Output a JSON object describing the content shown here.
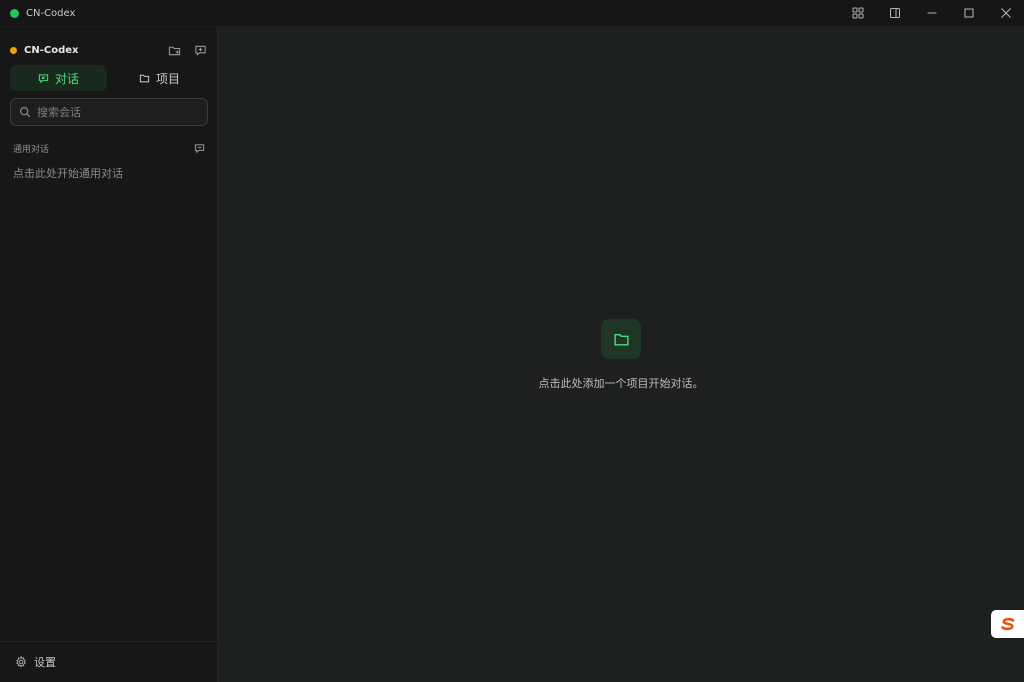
{
  "window": {
    "title": "CN-Codex",
    "status_color": "#22c55e"
  },
  "sidebar": {
    "workspace": {
      "name": "CN-Codex",
      "status_color": "#f59e0b"
    },
    "tabs": [
      {
        "label": "对话",
        "icon": "chat-icon",
        "active": true
      },
      {
        "label": "项目",
        "icon": "folder-icon",
        "active": false
      }
    ],
    "search": {
      "placeholder": "搜索会话",
      "value": ""
    },
    "section": {
      "title": "通用对话",
      "hint": "点击此处开始通用对话"
    },
    "footer": {
      "settings_label": "设置"
    }
  },
  "main": {
    "empty_state": {
      "icon": "folder-icon",
      "text": "点击此处添加一个项目开始对话。"
    }
  },
  "colors": {
    "accent": "#4ade80",
    "sidebar_bg": "#171717",
    "main_bg": "#1d201e"
  }
}
